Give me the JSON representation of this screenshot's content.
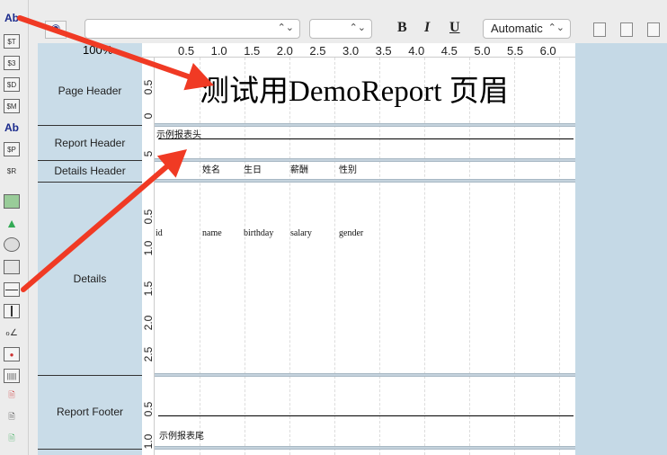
{
  "palette": {
    "items": [
      {
        "icon": "text-label-icon",
        "label": "Ab"
      },
      {
        "icon": "text-field-icon",
        "label": "$T"
      },
      {
        "icon": "number-field-icon",
        "label": "$3"
      },
      {
        "icon": "date-field-icon",
        "label": "$D"
      },
      {
        "icon": "money-field-icon",
        "label": "$M"
      },
      {
        "icon": "rich-text-icon",
        "label": "Ab"
      },
      {
        "icon": "parameter-icon",
        "label": "$P"
      },
      {
        "icon": "variable-icon",
        "label": "$R"
      },
      {
        "icon": "image-icon",
        "label": ""
      },
      {
        "icon": "shapes-icon",
        "label": ""
      },
      {
        "icon": "ellipse-icon",
        "label": ""
      },
      {
        "icon": "rectangle-icon",
        "label": ""
      },
      {
        "icon": "horizontal-line-icon",
        "label": ""
      },
      {
        "icon": "vertical-line-icon",
        "label": ""
      },
      {
        "icon": "signature-icon",
        "label": ""
      },
      {
        "icon": "chart-icon",
        "label": ""
      },
      {
        "icon": "barcode-icon",
        "label": ""
      },
      {
        "icon": "subreport-icon",
        "label": ""
      },
      {
        "icon": "subreport-chart-icon",
        "label": ""
      },
      {
        "icon": "subreport-pie-icon",
        "label": ""
      }
    ]
  },
  "toolbar": {
    "font_family": "",
    "font_size": "",
    "bold": "B",
    "italic": "I",
    "underline": "U",
    "color": "Automatic"
  },
  "zoom": "100%",
  "hruler": [
    "0.5",
    "1.0",
    "1.5",
    "2.0",
    "2.5",
    "3.0",
    "3.5",
    "4.0",
    "4.5",
    "5.0",
    "5.5",
    "6.0"
  ],
  "bands": {
    "page_header": "Page Header",
    "report_header": "Report Header",
    "details_header": "Details Header",
    "details": "Details",
    "report_footer": "Report Footer"
  },
  "vruler": {
    "page_header": [
      "0.5",
      "0"
    ],
    "report_header": [
      "5"
    ],
    "details": [
      "0.5",
      "1.0",
      "1.5",
      "2.0",
      "2.5"
    ],
    "report_footer": [
      "0.5",
      "1.0"
    ]
  },
  "report": {
    "title": "测试用DemoReport 页眉",
    "report_header_text": "示例报表头",
    "columns_header": [
      "姓名",
      "生日",
      "薪酬",
      "性别"
    ],
    "fields": [
      "id",
      "name",
      "birthday",
      "salary",
      "gender"
    ],
    "report_footer_text": "示例报表尾"
  },
  "annotation_color": "#f03a24"
}
